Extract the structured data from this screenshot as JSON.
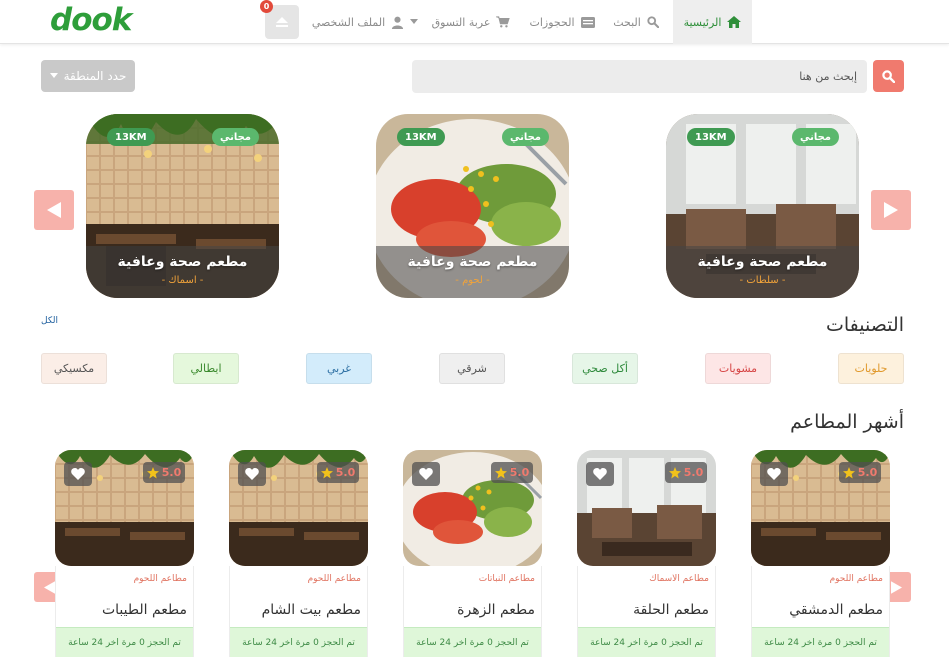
{
  "brand": {
    "logo": "dook"
  },
  "nav": {
    "items": [
      {
        "label": "الرئيسية",
        "icon": "home-icon"
      },
      {
        "label": "البحث",
        "icon": "search-icon"
      },
      {
        "label": "الحجوزات",
        "icon": "list-icon"
      },
      {
        "label": "عربة التسوق",
        "icon": "cart-icon"
      },
      {
        "label": "الملف الشخصي",
        "icon": "user-icon"
      }
    ],
    "notifications_count": "0"
  },
  "search": {
    "placeholder": "إبحث من هنا",
    "region_label": "حدد المنطقة"
  },
  "featured": [
    {
      "name": "مطعم صحة وعافية",
      "category": "سلطات",
      "free": "مجاني",
      "distance": "13KM",
      "image": "restaurant-windows"
    },
    {
      "name": "مطعم صحة وعافية",
      "category": "لحوم",
      "free": "مجاني",
      "distance": "13KM",
      "image": "salad-plate"
    },
    {
      "name": "مطعم صحة وعافية",
      "category": "اسماك",
      "free": "مجاني",
      "distance": "13KM",
      "image": "restaurant-plants"
    }
  ],
  "categories": {
    "title": "التصنيفات",
    "all_link": "الكل",
    "items": [
      {
        "label": "حلويات",
        "bg": "#fdf1dd",
        "color": "#e0982a"
      },
      {
        "label": "مشويات",
        "bg": "#fde6e6",
        "color": "#d64545"
      },
      {
        "label": "أكل صحي",
        "bg": "#e6f6e8",
        "color": "#2f8a3c"
      },
      {
        "label": "شرقي",
        "bg": "#efefef",
        "color": "#555555"
      },
      {
        "label": "غربي",
        "bg": "#d3ecfb",
        "color": "#2c6fa3"
      },
      {
        "label": "ايطالي",
        "bg": "#e5f8dc",
        "color": "#3b8a2e"
      },
      {
        "label": "مكسيكي",
        "bg": "#fbeee7",
        "color": "#555555"
      }
    ]
  },
  "popular": {
    "title": "أشهر المطاعم",
    "restaurants": [
      {
        "name": "مطعم الدمشقي",
        "category": "مطاعم اللحوم",
        "rating": "5.0",
        "status": "تم الحجز 0 مرة اخر 24 ساعة",
        "image": "restaurant-plants"
      },
      {
        "name": "مطعم الحلقة",
        "category": "مطاعم الاسماك",
        "rating": "5.0",
        "status": "تم الحجز 0 مرة اخر 24 ساعة",
        "image": "restaurant-windows"
      },
      {
        "name": "مطعم الزهرة",
        "category": "مطاعم النباتات",
        "rating": "5.0",
        "status": "تم الحجز 0 مرة اخر 24 ساعة",
        "image": "salad-plate"
      },
      {
        "name": "مطعم بيت الشام",
        "category": "مطاعم اللحوم",
        "rating": "5.0",
        "status": "تم الحجز 0 مرة اخر 24 ساعة",
        "image": "restaurant-plants"
      },
      {
        "name": "مطعم الطيبات",
        "category": "مطاعم اللحوم",
        "rating": "5.0",
        "status": "تم الحجز 0 مرة اخر 24 ساعة",
        "image": "restaurant-plants"
      }
    ]
  },
  "colors": {
    "accent": "#f07a6e",
    "brand": "#2e9e3a"
  }
}
